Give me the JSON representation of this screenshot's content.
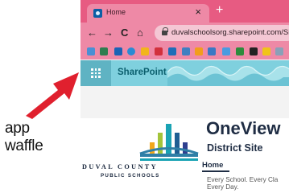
{
  "annotation": {
    "line1": "app",
    "line2": "waffle",
    "arrow_color": "#e0202e"
  },
  "browser": {
    "tab": {
      "title": "Home",
      "favicon": "sharepoint-favicon",
      "close_icon": "×"
    },
    "new_tab_icon": "+",
    "nav": {
      "back": "←",
      "forward": "→",
      "reload": "C",
      "home": "⌂"
    },
    "url": "duvalschoolsorg.sharepoint.com/Sites",
    "theme_color": "#e75b82"
  },
  "suite_bar": {
    "waffle_icon": "app-launcher-waffle-icon",
    "brand": "SharePoint",
    "color": "#7fd0de"
  },
  "site": {
    "logo_line1": "DUVAL COUNTY",
    "logo_line2": "PUBLIC SCHOOLS",
    "title": "OneView",
    "subtitle": "District Site",
    "nav_home": "Home",
    "tagline": "Every School. Every Cla\nEvery Day."
  }
}
